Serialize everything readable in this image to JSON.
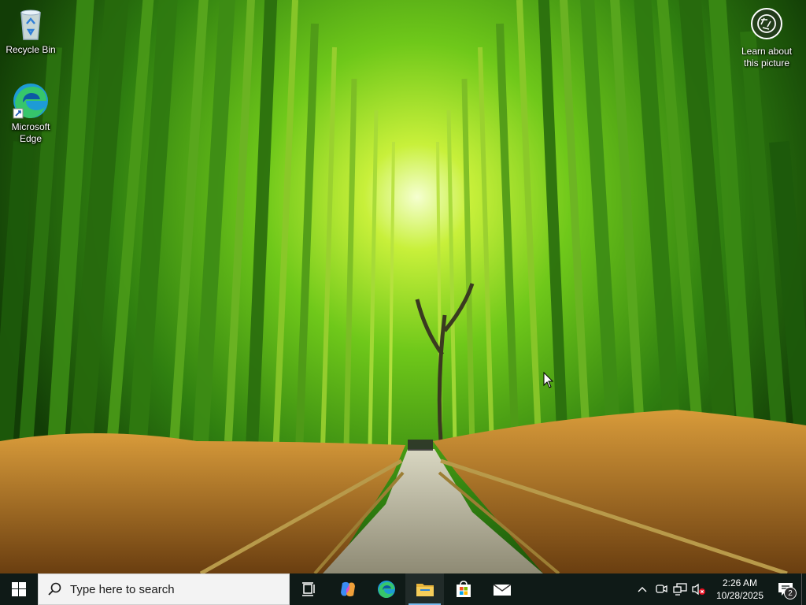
{
  "desktop": {
    "icons": [
      {
        "label": "Recycle Bin",
        "icon": "recycle-bin-icon"
      },
      {
        "label": "Microsoft\nEdge",
        "icon": "edge-icon"
      }
    ],
    "learn_about_picture": {
      "label": "Learn about\nthis picture",
      "icon": "camera-lens-icon"
    }
  },
  "taskbar": {
    "search_placeholder": "Type here to search",
    "pinned": [
      {
        "name": "Task View",
        "icon": "task-view-icon"
      },
      {
        "name": "Copilot",
        "icon": "copilot-icon"
      },
      {
        "name": "Microsoft Edge",
        "icon": "edge-icon"
      },
      {
        "name": "File Explorer",
        "icon": "folder-icon",
        "active": true
      },
      {
        "name": "Microsoft Store",
        "icon": "store-icon"
      },
      {
        "name": "Mail",
        "icon": "mail-icon"
      }
    ],
    "tray": {
      "icons": [
        "chevron-up-icon",
        "meet-now-icon",
        "network-icon",
        "volume-muted-icon"
      ],
      "time": "2:26 AM",
      "date": "10/28/2025",
      "notification_count": "2"
    }
  },
  "colors": {
    "taskbar_bg": "#0f1a17",
    "accent": "#76b9ed",
    "bamboo_light": "#b6e61e",
    "bamboo_dark": "#1f5a0c",
    "grass": "#b8771e"
  }
}
